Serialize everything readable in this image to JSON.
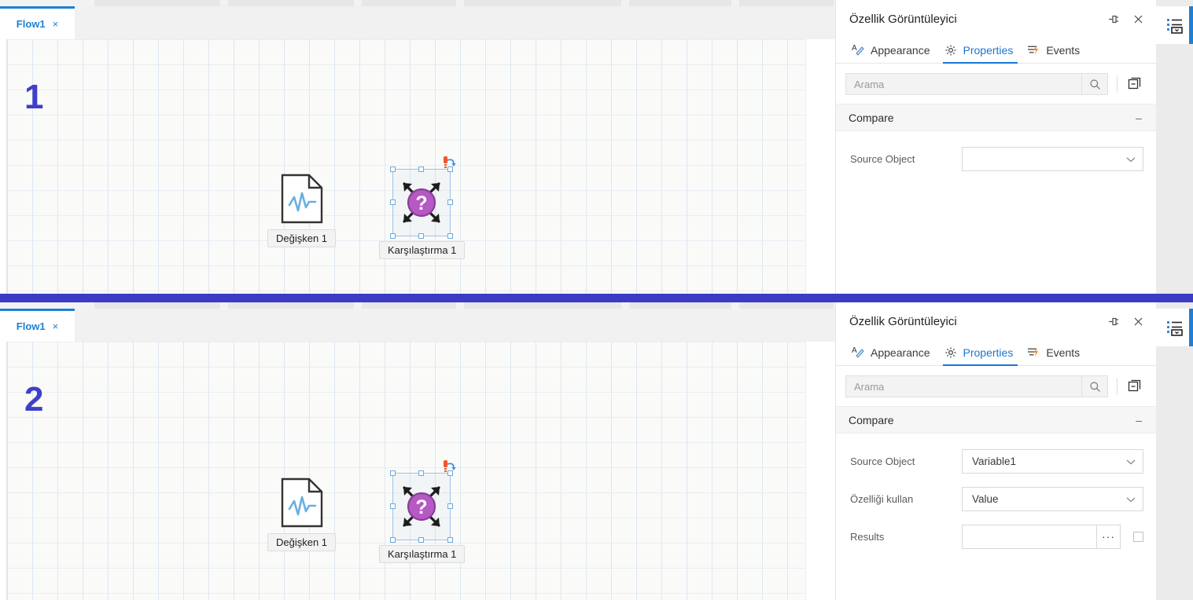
{
  "app": {
    "divider_color": "#3b3bc4",
    "accent_color": "#1876d2",
    "step_color": "#3f3fc8"
  },
  "shots": [
    {
      "step_number": "1",
      "tab": {
        "label": "Flow1",
        "close": "×"
      },
      "nodes": [
        {
          "icon": "variable-document-icon",
          "label": "Değişken 1",
          "selected": false
        },
        {
          "icon": "comparison-question-icon",
          "label": "Karşılaştırma 1",
          "selected": true
        }
      ],
      "panel": {
        "title": "Özellik Görüntüleyici",
        "pin_icon": "pin-icon",
        "close_icon": "close-icon",
        "tabs": [
          {
            "label": "Appearance",
            "icon": "appearance-icon",
            "active": false
          },
          {
            "label": "Properties",
            "icon": "gear-icon",
            "active": true
          },
          {
            "label": "Events",
            "icon": "events-lightning-icon",
            "active": false
          }
        ],
        "search": {
          "value": "",
          "placeholder": "Arama",
          "icon": "search-icon"
        },
        "collapse_all_icon": "collapse-all-icon",
        "group": {
          "title": "Compare",
          "toggle": "–"
        },
        "rows": [
          {
            "label": "Source Object",
            "type": "select",
            "value": "",
            "chevron": "⌄"
          }
        ]
      },
      "rail": {
        "icon": "property-list-icon"
      }
    },
    {
      "step_number": "2",
      "tab": {
        "label": "Flow1",
        "close": "×"
      },
      "nodes": [
        {
          "icon": "variable-document-icon",
          "label": "Değişken 1",
          "selected": false
        },
        {
          "icon": "comparison-question-icon",
          "label": "Karşılaştırma 1",
          "selected": true
        }
      ],
      "panel": {
        "title": "Özellik Görüntüleyici",
        "pin_icon": "pin-icon",
        "close_icon": "close-icon",
        "tabs": [
          {
            "label": "Appearance",
            "icon": "appearance-icon",
            "active": false
          },
          {
            "label": "Properties",
            "icon": "gear-icon",
            "active": true
          },
          {
            "label": "Events",
            "icon": "events-lightning-icon",
            "active": false
          }
        ],
        "search": {
          "value": "",
          "placeholder": "Arama",
          "icon": "search-icon"
        },
        "collapse_all_icon": "collapse-all-icon",
        "group": {
          "title": "Compare",
          "toggle": "–"
        },
        "rows": [
          {
            "label": "Source Object",
            "type": "select",
            "value": "Variable1",
            "chevron": "⌄"
          },
          {
            "label": "Özelliği kullan",
            "type": "select",
            "value": "Value",
            "chevron": "⌄"
          },
          {
            "label": "Results",
            "type": "textbox",
            "value": "",
            "ellipsis": "···",
            "has_checkbox": true
          }
        ]
      },
      "rail": {
        "icon": "property-list-icon"
      }
    }
  ]
}
